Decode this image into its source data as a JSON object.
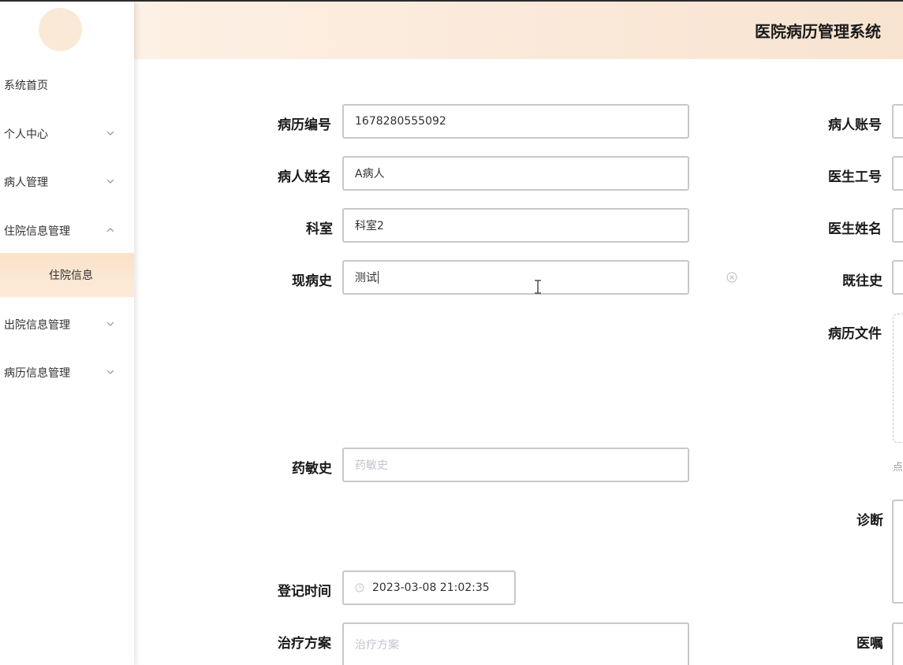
{
  "app": {
    "title": "医院病历管理系统"
  },
  "sidebar": {
    "items": [
      {
        "label": "系统首页",
        "chevron": "none"
      },
      {
        "label": "个人中心",
        "chevron": "down"
      },
      {
        "label": "病人管理",
        "chevron": "down"
      },
      {
        "label": "住院信息管理",
        "chevron": "up"
      },
      {
        "label": "出院信息管理",
        "chevron": "down"
      },
      {
        "label": "病历信息管理",
        "chevron": "down"
      }
    ],
    "subitem": {
      "label": "住院信息"
    }
  },
  "form": {
    "record_no": {
      "label": "病历编号",
      "value": "1678280555092"
    },
    "patient_name": {
      "label": "病人姓名",
      "value": "A病人"
    },
    "department": {
      "label": "科室",
      "value": "科室2"
    },
    "present_illness": {
      "label": "现病史",
      "value": "测试"
    },
    "drug_allergy": {
      "label": "药敏史",
      "placeholder": "药敏史"
    },
    "register_time": {
      "label": "登记时间",
      "value": "2023-03-08 21:02:35"
    },
    "treatment_plan": {
      "label": "治疗方案",
      "placeholder": "治疗方案"
    },
    "patient_account": {
      "label": "病人账号"
    },
    "doctor_id": {
      "label": "医生工号"
    },
    "doctor_name": {
      "label": "医生姓名"
    },
    "past_history": {
      "label": "既往史"
    },
    "record_file": {
      "label": "病历文件",
      "hint": "点"
    },
    "diagnosis": {
      "label": "诊断"
    },
    "doctor_advice": {
      "label": "医嘱"
    }
  },
  "colors": {
    "header_gradient_start": "#fdf0e4",
    "header_gradient_end": "#f8e3d0",
    "active_submenu": "#fbe2c9",
    "avatar": "#fbe9d7",
    "border": "#c8c8c8",
    "placeholder": "#c0c4cc"
  },
  "icons": {
    "menu_chevron": "chevron-icon",
    "clear": "circle-close-icon",
    "time": "clock-icon",
    "cursor": "text-cursor-icon"
  }
}
